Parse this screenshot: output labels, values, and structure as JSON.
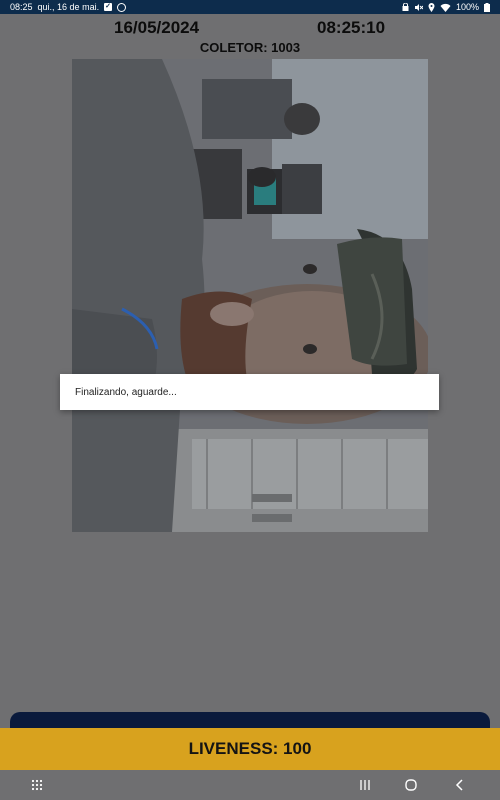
{
  "status_bar": {
    "time": "08:25",
    "date": "qui., 16 de mai.",
    "battery": "100%"
  },
  "header": {
    "date": "16/05/2024",
    "time": "08:25:10",
    "collector": "COLETOR: 1003"
  },
  "dialog": {
    "message": "Finalizando, aguarde..."
  },
  "footer": {
    "liveness": "LIVENESS: 100"
  },
  "colors": {
    "status_bar": "#0d2c4c",
    "accent": "#d8a21e",
    "dim_background": "#6f6f71",
    "navy": "#0a1a3c"
  }
}
